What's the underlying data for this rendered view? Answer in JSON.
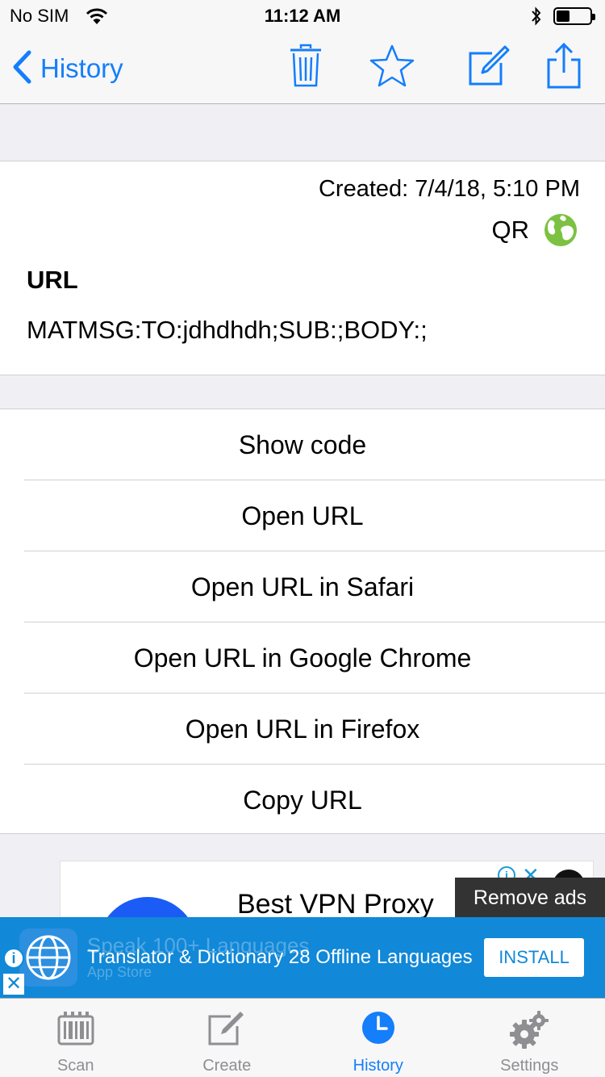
{
  "status_bar": {
    "carrier": "No SIM",
    "time": "11:12 AM"
  },
  "nav": {
    "back_label": "History",
    "icons": [
      "trash-icon",
      "star-icon",
      "edit-icon",
      "share-icon"
    ]
  },
  "details": {
    "created": "Created: 7/4/18, 5:10 PM",
    "format": "QR",
    "type_label": "URL",
    "content": "MATMSG:TO:jdhdhdh;SUB:;BODY:;"
  },
  "actions": [
    {
      "label": "Show code"
    },
    {
      "label": "Open URL"
    },
    {
      "label": "Open URL in Safari"
    },
    {
      "label": "Open URL in Google Chrome"
    },
    {
      "label": "Open URL in Firefox"
    },
    {
      "label": "Copy URL"
    }
  ],
  "ad_card": {
    "title": "Best VPN Proxy"
  },
  "remove_ads": "Remove ads",
  "banner": {
    "ghost_title": "Speak 100+ Languages",
    "ghost_sub": "App Store",
    "text": "Translator & Dictionary 28 Offline Languages",
    "install_label": "INSTALL"
  },
  "tabs": [
    {
      "label": "Scan",
      "icon": "barcode-icon"
    },
    {
      "label": "Create",
      "icon": "edit-icon"
    },
    {
      "label": "History",
      "icon": "clock-icon",
      "active": true
    },
    {
      "label": "Settings",
      "icon": "gear-icon"
    }
  ],
  "colors": {
    "accent": "#147efb",
    "banner": "#1188d8",
    "globe": "#7cc142"
  }
}
